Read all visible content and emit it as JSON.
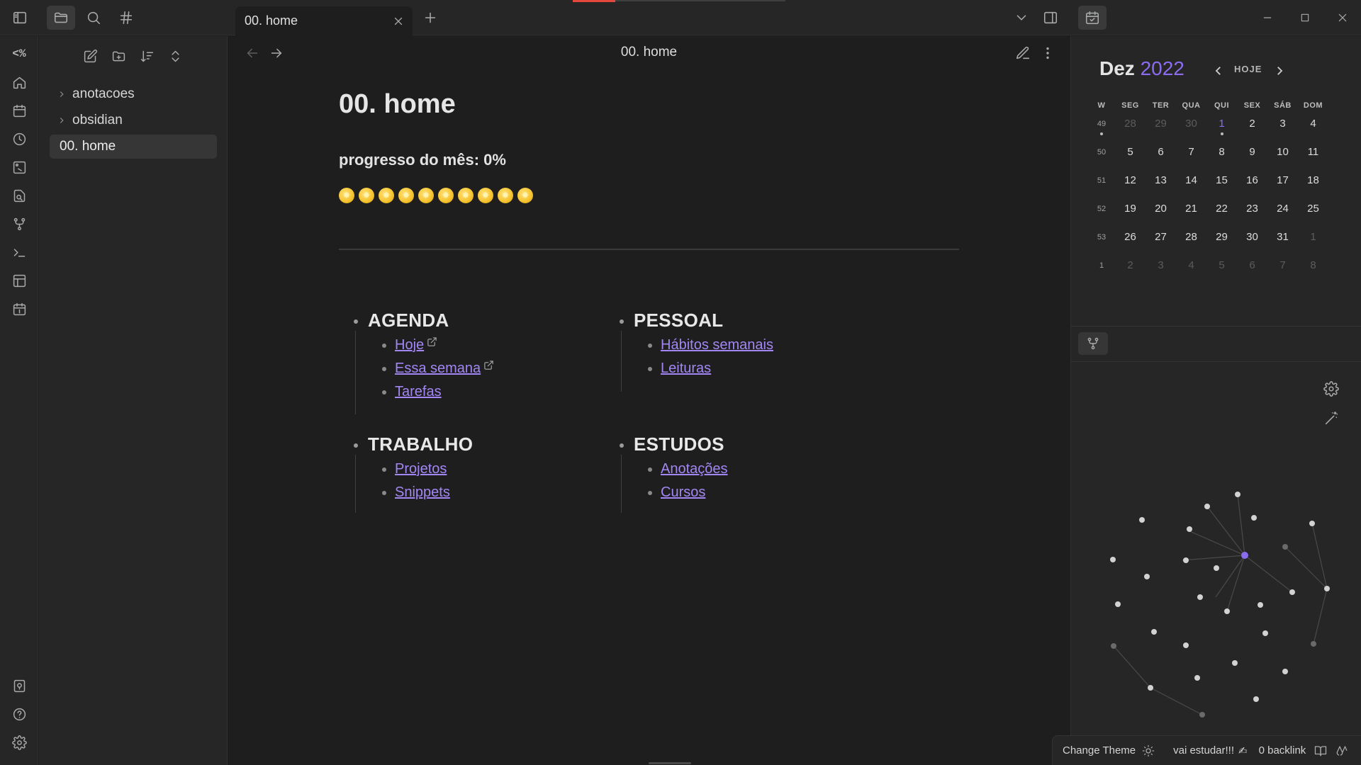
{
  "titlebar": {
    "tab_title": "00. home"
  },
  "ribbon": {
    "code_label": "<%"
  },
  "explorer": {
    "items": [
      {
        "label": "anotacoes",
        "type": "folder"
      },
      {
        "label": "obsidian",
        "type": "folder"
      },
      {
        "label": "00. home",
        "type": "file",
        "active": true
      }
    ]
  },
  "editor": {
    "view_title": "00. home",
    "note_title": "00. home",
    "progress_text": "progresso do mês: 0%",
    "progress_value": 0,
    "star_count": 10,
    "sections": [
      {
        "title": "AGENDA",
        "links": [
          {
            "label": "Hoje",
            "external": true
          },
          {
            "label": "Essa semana",
            "external": true
          },
          {
            "label": "Tarefas",
            "external": false
          }
        ]
      },
      {
        "title": "PESSOAL",
        "links": [
          {
            "label": "Hábitos semanais",
            "external": false
          },
          {
            "label": "Leituras",
            "external": false
          }
        ]
      },
      {
        "title": "TRABALHO",
        "links": [
          {
            "label": "Projetos",
            "external": false
          },
          {
            "label": "Snippets",
            "external": false
          }
        ]
      },
      {
        "title": "ESTUDOS",
        "links": [
          {
            "label": "Anotações",
            "external": false
          },
          {
            "label": "Cursos",
            "external": false
          }
        ]
      }
    ]
  },
  "calendar": {
    "month": "Dez",
    "year": "2022",
    "today_label": "HOJE",
    "headers": [
      "W",
      "SEG",
      "TER",
      "QUA",
      "QUI",
      "SEX",
      "SÁB",
      "DOM"
    ],
    "weeks": [
      {
        "wk": "49",
        "days": [
          "28",
          "29",
          "30",
          "1",
          "2",
          "3",
          "4"
        ]
      },
      {
        "wk": "50",
        "days": [
          "5",
          "6",
          "7",
          "8",
          "9",
          "10",
          "11"
        ]
      },
      {
        "wk": "51",
        "days": [
          "12",
          "13",
          "14",
          "15",
          "16",
          "17",
          "18"
        ]
      },
      {
        "wk": "52",
        "days": [
          "19",
          "20",
          "21",
          "22",
          "23",
          "24",
          "25"
        ]
      },
      {
        "wk": "53",
        "days": [
          "26",
          "27",
          "28",
          "29",
          "30",
          "31",
          "1"
        ]
      },
      {
        "wk": "1",
        "days": [
          "2",
          "3",
          "4",
          "5",
          "6",
          "7",
          "8"
        ]
      }
    ],
    "accent_color": "#8b6cf0"
  },
  "statusbar": {
    "change_theme": "Change Theme",
    "message": "vai estudar!!!",
    "backlinks": "0 backlink"
  },
  "colors": {
    "link": "#a287f4",
    "accent": "#8b6cf0",
    "background": "#1e1e1e",
    "panel": "#262626"
  }
}
